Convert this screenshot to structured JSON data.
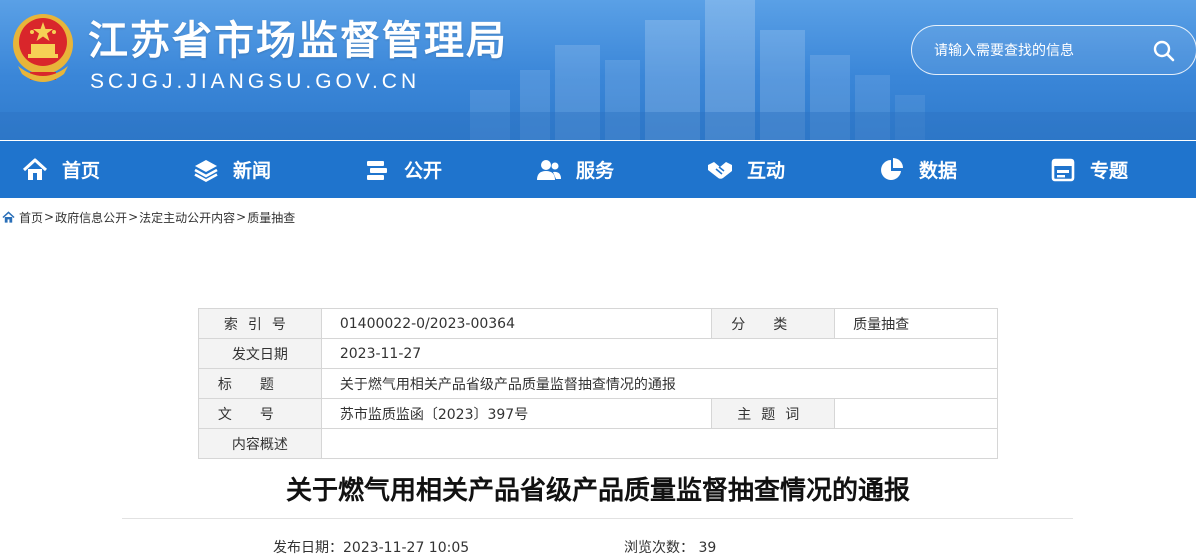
{
  "header": {
    "site_title": "江苏省市场监督管理局",
    "site_domain": "SCJGJ.JIANGSU.GOV.CN",
    "search_placeholder": "请输入需要查找的信息",
    "brand_color": "#1f74cd"
  },
  "nav": {
    "items": [
      {
        "label": "首页",
        "icon": "home-icon"
      },
      {
        "label": "新闻",
        "icon": "layers-icon"
      },
      {
        "label": "公开",
        "icon": "books-icon"
      },
      {
        "label": "服务",
        "icon": "users-icon"
      },
      {
        "label": "互动",
        "icon": "handshake-icon"
      },
      {
        "label": "数据",
        "icon": "pie-chart-icon"
      },
      {
        "label": "专题",
        "icon": "calendar-icon"
      }
    ]
  },
  "breadcrumb": {
    "items": [
      "首页",
      "政府信息公开",
      "法定主动公开内容",
      "质量抽查"
    ],
    "separator": ">"
  },
  "meta": {
    "index_label": "索引号",
    "index_value": "01400022-0/2023-00364",
    "category_label": "分类",
    "category_value": "质量抽查",
    "date_label": "发文日期",
    "date_value": "2023-11-27",
    "title_label": "标题",
    "title_value": "关于燃气用相关产品省级产品质量监督抽查情况的通报",
    "docno_label": "文号",
    "docno_value": "苏市监质监函〔2023〕397号",
    "subject_label": "主题词",
    "subject_value": "",
    "summary_label": "内容概述",
    "summary_value": ""
  },
  "article": {
    "title": "关于燃气用相关产品省级产品质量监督抽查情况的通报",
    "publish_date_label": "发布日期：",
    "publish_date": "2023-11-27 10:05",
    "views_label": "浏览次数：",
    "views": "39"
  }
}
